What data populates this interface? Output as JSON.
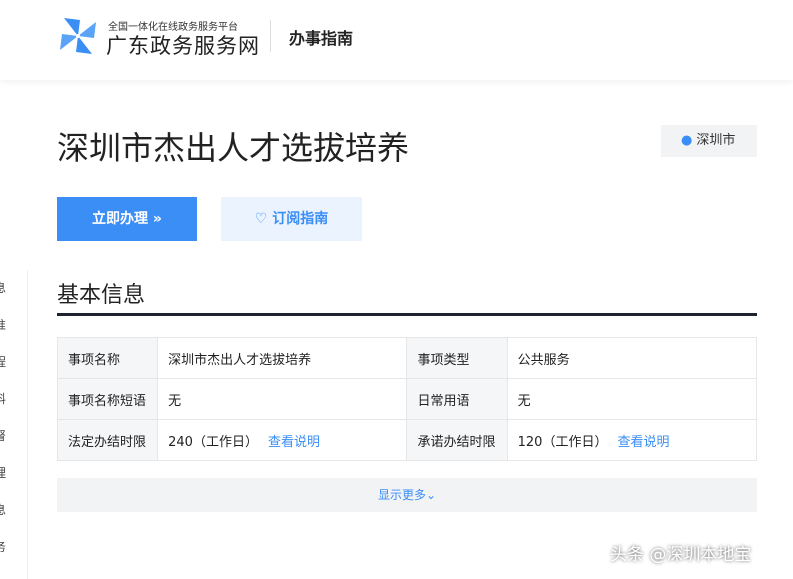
{
  "header": {
    "logo_sub": "全国一体化在线政务服务平台",
    "logo_main": "广东政务服务网",
    "section": "办事指南"
  },
  "sidebar": [
    "息",
    "准",
    "程",
    "料",
    "督",
    "理",
    "息",
    "务"
  ],
  "page": {
    "title": "深圳市杰出人才选拔培养",
    "location": "深圳市",
    "apply_button": "立即办理 »",
    "subscribe_button": "订阅指南"
  },
  "basic": {
    "heading": "基本信息",
    "rows": [
      {
        "k1": "事项名称",
        "v1": "深圳市杰出人才选拔培养",
        "k2": "事项类型",
        "v2": "公共服务"
      },
      {
        "k1": "事项名称短语",
        "v1": "无",
        "k2": "日常用语",
        "v2": "无"
      },
      {
        "k1": "法定办结时限",
        "v1": "240（工作日）",
        "l1": "查看说明",
        "k2": "承诺办结时限",
        "v2": "120（工作日）",
        "l2": "查看说明"
      }
    ],
    "more": "显示更多⌄"
  },
  "watermark": "头条 @深圳本地宝"
}
